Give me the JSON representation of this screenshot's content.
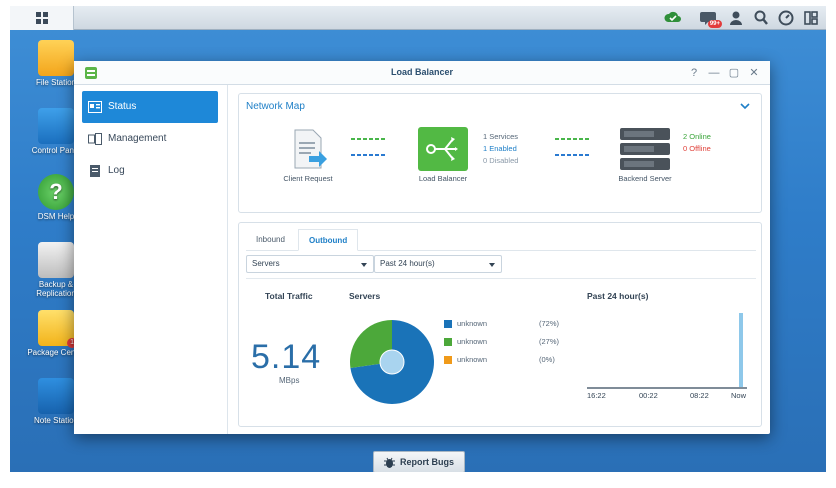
{
  "desktop": {
    "icons": [
      {
        "label": "File Station"
      },
      {
        "label": "Control Panel"
      },
      {
        "label": "DSM Help"
      },
      {
        "label": "Backup & Replication"
      },
      {
        "label": "Package Center",
        "badge": "1"
      },
      {
        "label": "Note Station"
      }
    ]
  },
  "taskbar": {
    "tray_icons": [
      "cloud-sync-icon",
      "chat-icon",
      "user-icon",
      "search-icon",
      "gauge-icon",
      "widgets-icon"
    ],
    "chat_badge": "99+"
  },
  "window": {
    "title": "Load Balancer",
    "controls": [
      "?",
      "—",
      "▢",
      "✕"
    ]
  },
  "sidebar": {
    "items": [
      {
        "label": "Status",
        "icon": "status-icon",
        "active": true
      },
      {
        "label": "Management",
        "icon": "management-icon",
        "active": false
      },
      {
        "label": "Log",
        "icon": "log-icon",
        "active": false
      }
    ]
  },
  "network_map": {
    "title": "Network Map",
    "client_label": "Client Request",
    "balancer_label": "Load Balancer",
    "backend_label": "Backend Server",
    "services": "1 Services",
    "enabled": "1 Enabled",
    "disabled": "0 Disabled",
    "online": "2 Online",
    "offline": "0 Offline"
  },
  "traffic": {
    "tabs": [
      {
        "label": "Inbound",
        "active": false
      },
      {
        "label": "Outbound",
        "active": true
      }
    ],
    "server_select": "Servers",
    "time_select": "Past 24 hour(s)",
    "total_title": "Total Traffic",
    "servers_title": "Servers",
    "past_title": "Past 24 hour(s)",
    "total_value": "5.14",
    "total_unit": "MBps",
    "legend": [
      {
        "name": "unknown",
        "pct": "(72%)",
        "color": "#1a73b8"
      },
      {
        "name": "unknown",
        "pct": "(27%)",
        "color": "#4ca83a"
      },
      {
        "name": "unknown",
        "pct": "(0%)",
        "color": "#f09a1a"
      }
    ],
    "x_ticks": [
      "16:22",
      "00:22",
      "08:22",
      "Now"
    ]
  },
  "colors": {
    "accent": "#1e88d8",
    "online": "#3aa53a",
    "offline": "#e0413a"
  },
  "report_button": {
    "label": "Report Bugs"
  },
  "chart_data": [
    {
      "type": "pie",
      "title": "Servers",
      "categories": [
        "unknown",
        "unknown",
        "unknown"
      ],
      "values": [
        72,
        27,
        0
      ],
      "colors": [
        "#1a73b8",
        "#4ca83a",
        "#f09a1a"
      ]
    },
    {
      "type": "bar",
      "title": "Past 24 hour(s)",
      "categories": [
        "16:22",
        "00:22",
        "08:22",
        "Now"
      ],
      "x_ticks": [
        "16:22",
        "00:22",
        "08:22",
        "Now"
      ],
      "values": [
        0,
        0,
        0,
        5.14
      ],
      "grid": false
    }
  ]
}
